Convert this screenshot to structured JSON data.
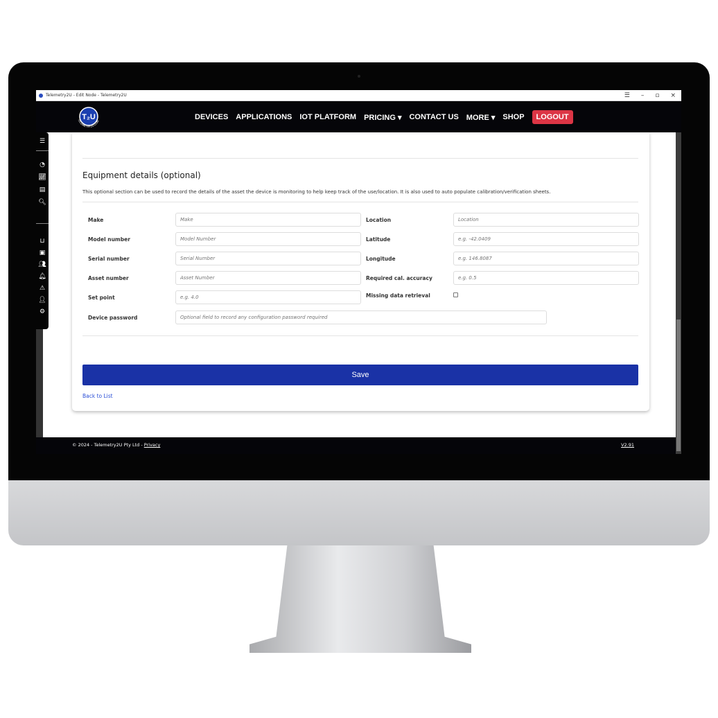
{
  "window": {
    "title": "Telemetry2U - Edit Node - Telemetry2U",
    "controls": [
      "☰",
      "–",
      "▫",
      "×"
    ]
  },
  "nav": {
    "logo": "T2U TELEMETRY2U.COM",
    "items": [
      "DEVICES",
      "APPLICATIONS",
      "IOT PLATFORM",
      "PRICING ▾",
      "CONTACT US",
      "MORE ▾",
      "SHOP"
    ],
    "logout": "LOGOUT"
  },
  "sidebar": {
    "icons": [
      "menu-icon",
      "dashboard-icon",
      "chart-icon",
      "report-icon",
      "search-report-icon",
      "gateway-icon",
      "device-icon",
      "users-icon",
      "bell-icon",
      "warning-icon",
      "alert-user-icon",
      "settings-report-icon"
    ]
  },
  "section": {
    "title": "Equipment details (optional)",
    "description": "This optional section can be used to record the details of the asset the device is monitoring to help keep track of the use/location. It is also used to auto populate calibration/verification sheets."
  },
  "left_fields": [
    {
      "label": "Make",
      "placeholder": "Make"
    },
    {
      "label": "Model number",
      "placeholder": "Model Number"
    },
    {
      "label": "Serial number",
      "placeholder": "Serial Number"
    },
    {
      "label": "Asset number",
      "placeholder": "Asset Number"
    },
    {
      "label": "Set point",
      "placeholder": "e.g. 4.0"
    }
  ],
  "right_fields": [
    {
      "label": "Location",
      "placeholder": "Location"
    },
    {
      "label": "Latitude",
      "placeholder": "e.g. -42.0409"
    },
    {
      "label": "Longitude",
      "placeholder": "e.g. 146.8087"
    },
    {
      "label": "Required cal. accuracy",
      "placeholder": "e.g. 0.5"
    }
  ],
  "missing_data": {
    "label": "Missing data retrieval",
    "checked": false
  },
  "password": {
    "label": "Device password",
    "placeholder": "Optional field to record any configuration password required"
  },
  "actions": {
    "save": "Save",
    "back": "Back to List"
  },
  "footer": {
    "copyright": "© 2024 - Telemetry2U Pty Ltd - ",
    "privacy": "Privacy",
    "version": "V2.91"
  },
  "colors": {
    "save": "#1a32a6",
    "logout": "#dc3545",
    "link": "#2b4fd6"
  }
}
